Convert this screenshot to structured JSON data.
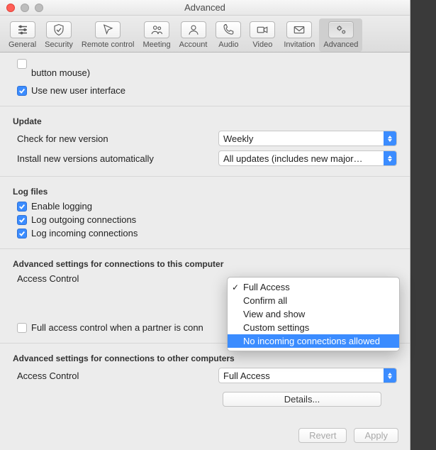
{
  "window": {
    "title": "Advanced"
  },
  "toolbar": {
    "items": [
      {
        "label": "General"
      },
      {
        "label": "Security"
      },
      {
        "label": "Remote control"
      },
      {
        "label": "Meeting"
      },
      {
        "label": "Account"
      },
      {
        "label": "Audio"
      },
      {
        "label": "Video"
      },
      {
        "label": "Invitation"
      },
      {
        "label": "Advanced"
      }
    ]
  },
  "truncated": {
    "line": "button mouse)"
  },
  "general": {
    "use_new_ui": "Use new user interface"
  },
  "update": {
    "heading": "Update",
    "check_label": "Check for new version",
    "check_value": "Weekly",
    "install_label": "Install new versions automatically",
    "install_value": "All updates (includes new major…"
  },
  "log": {
    "heading": "Log files",
    "enable": "Enable logging",
    "outgoing": "Log outgoing connections",
    "incoming": "Log incoming connections"
  },
  "adv_this": {
    "heading": "Advanced settings for connections to this computer",
    "access_label": "Access Control",
    "full_access_partner": "Full access control when a partner is conn",
    "menu": [
      "Full Access",
      "Confirm all",
      "View and show",
      "Custom settings",
      "No incoming connections allowed"
    ]
  },
  "adv_other": {
    "heading": "Advanced settings for connections to other computers",
    "access_label": "Access Control",
    "access_value": "Full Access",
    "details": "Details..."
  },
  "footer": {
    "revert": "Revert",
    "apply": "Apply"
  }
}
